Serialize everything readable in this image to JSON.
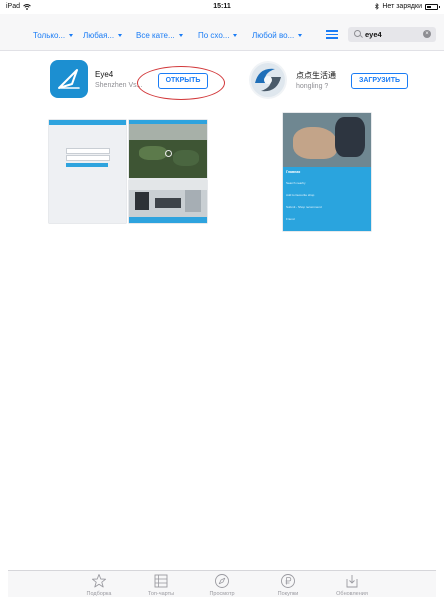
{
  "status_bar": {
    "device": "iPad",
    "time": "15:11",
    "charging_text": "Нет зарядки"
  },
  "filters": [
    {
      "label": "Только..."
    },
    {
      "label": "Любая..."
    },
    {
      "label": "Все кате..."
    },
    {
      "label": "По схо..."
    },
    {
      "label": "Любой во..."
    }
  ],
  "search": {
    "value": "eye4"
  },
  "apps": [
    {
      "name": "Eye4",
      "developer": "Shenzhen Vs...",
      "button": "ОТКРЫТЬ"
    },
    {
      "name": "点点生活通",
      "developer": "hongling ?",
      "button": "ЗАГРУЗИТЬ"
    }
  ],
  "shot_texts": {
    "menu_title": "Главная",
    "menu_items": [
      "Search nearby",
      "Add to favourite shop",
      "Submit - Shop recommend",
      "Friend"
    ]
  },
  "tabbar": [
    {
      "label": "Подборка",
      "icon": "star-icon"
    },
    {
      "label": "Топ-чарты",
      "icon": "list-icon"
    },
    {
      "label": "Просмотр",
      "icon": "compass-icon"
    },
    {
      "label": "Покупки",
      "icon": "purchased-icon"
    },
    {
      "label": "Обновления",
      "icon": "download-icon"
    }
  ],
  "colors": {
    "accent": "#1a7cf5",
    "highlight_circle": "#d2383a",
    "eye4_icon": "#1c8fd1",
    "app_blue": "#29a4e0"
  }
}
